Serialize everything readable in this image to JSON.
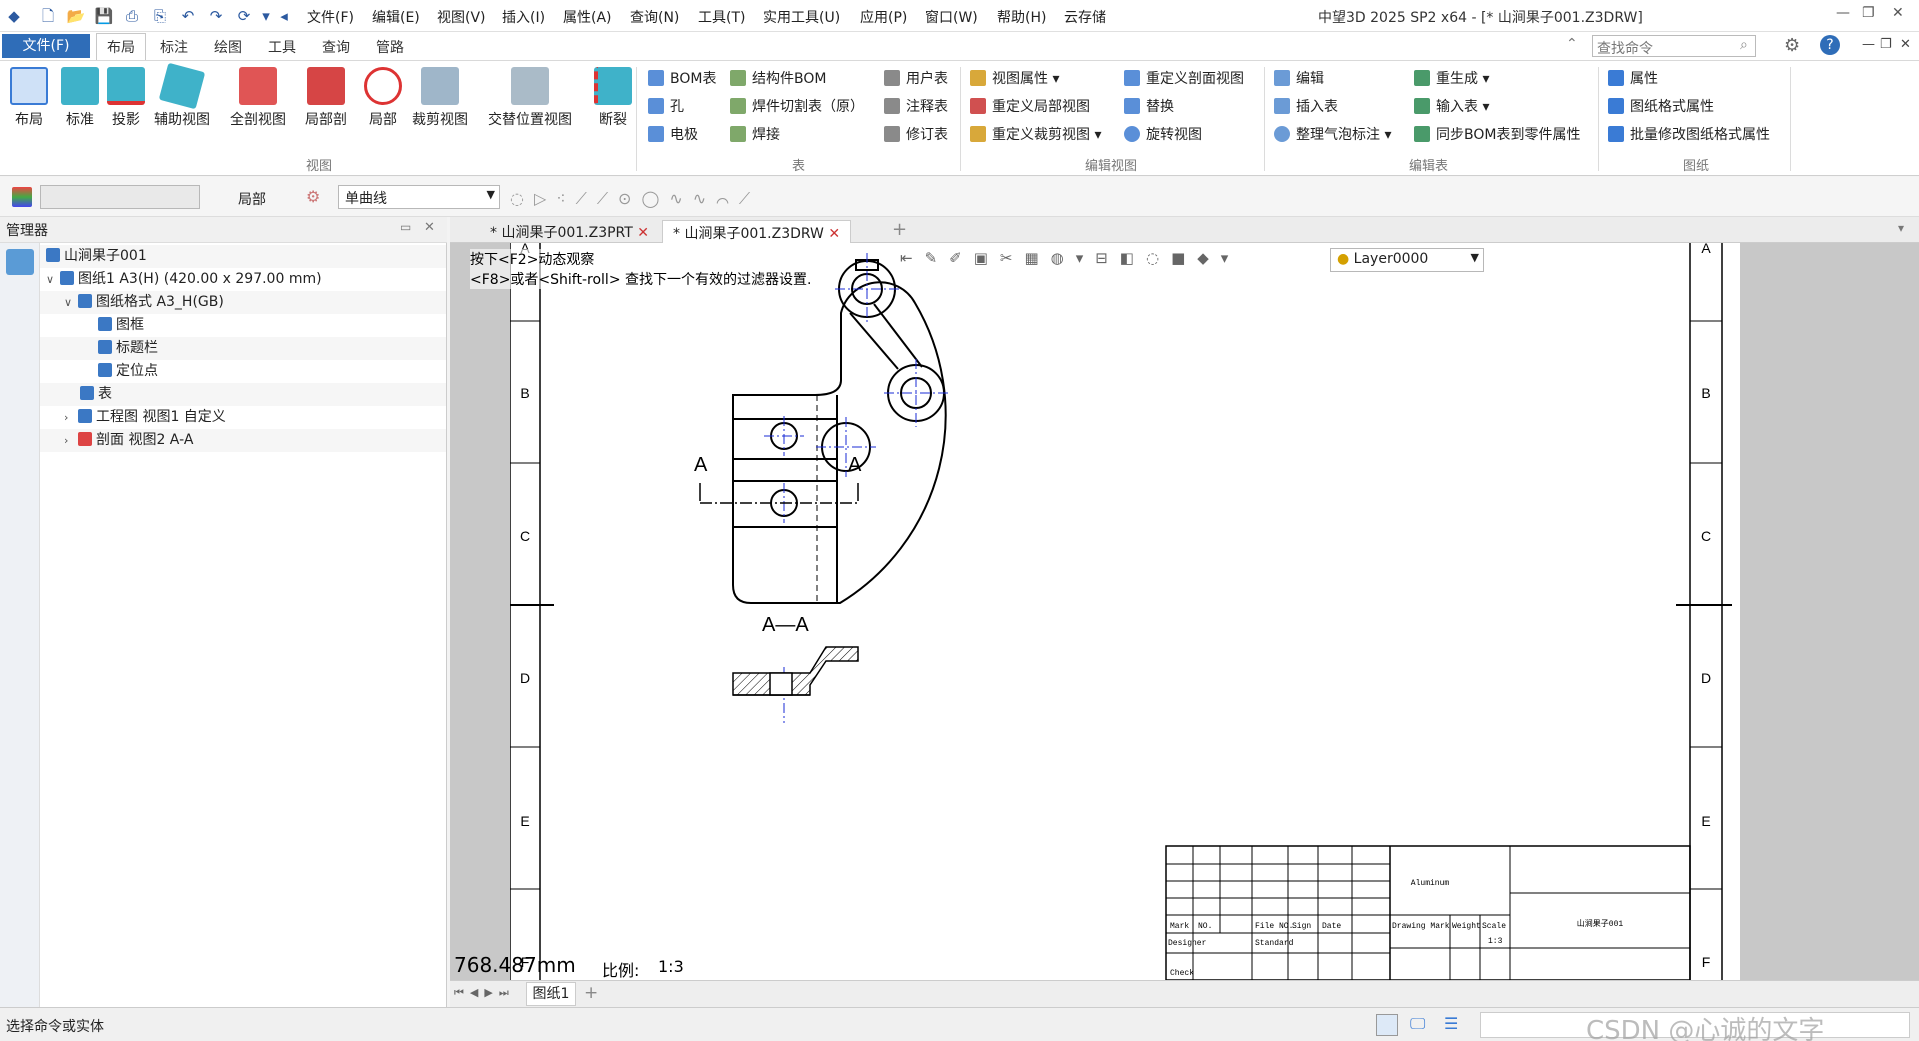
{
  "title_bar": {
    "menus": [
      "文件(F)",
      "编辑(E)",
      "视图(V)",
      "插入(I)",
      "属性(A)",
      "查询(N)",
      "工具(T)",
      "实用工具(U)",
      "应用(P)",
      "窗口(W)",
      "帮助(H)",
      "云存储"
    ],
    "window_title": "中望3D 2025 SP2 x64 - [* 山涧果子001.Z3DRW]"
  },
  "ribbon_tabs": {
    "file": "文件(F)",
    "tabs": [
      "布局",
      "标注",
      "绘图",
      "工具",
      "查询",
      "管路"
    ],
    "active": "布局",
    "search_placeholder": "查找命令"
  },
  "ribbon": {
    "view_buttons": [
      "布局",
      "标准",
      "投影",
      "辅助视图",
      "全剖视图",
      "局部剖",
      "局部",
      "裁剪视图",
      "交替位置视图",
      "断裂"
    ],
    "view_group": "视图",
    "table_buttons": [
      "BOM表",
      "孔",
      "电极",
      "结构件BOM",
      "焊件切割表（原）",
      "焊接",
      "用户表",
      "注释表",
      "修订表"
    ],
    "table_group": "表",
    "editview_buttons": [
      "视图属性",
      "重定义局部视图",
      "重定义裁剪视图",
      "重定义剖面视图",
      "替换",
      "旋转视图"
    ],
    "editview_group": "编辑视图",
    "edittable_buttons": [
      "编辑",
      "插入表",
      "整理气泡标注",
      "重生成",
      "输入表",
      "同步BOM表到零件属性"
    ],
    "edittable_group": "编辑表",
    "sheet_buttons": [
      "属性",
      "图纸格式属性",
      "批量修改图纸格式属性"
    ],
    "sheet_group": "图纸"
  },
  "filter_bar": {
    "scope_label": "局部",
    "curve_type": "单曲线"
  },
  "manager": {
    "title": "管理器",
    "tree": [
      "山涧果子001",
      "图纸1 A3(H) (420.00 x 297.00 mm)",
      "图纸格式 A3_H(GB)",
      "图框",
      "标题栏",
      "定位点",
      "表",
      "工程图 视图1 自定义",
      "剖面 视图2 A-A"
    ]
  },
  "doc_tabs": [
    "* 山涧果子001.Z3PRT",
    "* 山涧果子001.Z3DRW"
  ],
  "canvas": {
    "hint1": "按下<F2>动态观察",
    "hint2": "<F8>或者<Shift-roll> 查找下一个有效的过滤器设置.",
    "layer": "Layer0000",
    "zone_labels": [
      "A",
      "B",
      "C",
      "D",
      "E",
      "F"
    ],
    "section_label": "A—A",
    "section_arrow": "A",
    "measure": "768.487mm",
    "scale_label": "比例:",
    "scale_value": "1:3",
    "title_block": {
      "material": "Aluminum",
      "name": "山涧果子001",
      "headers": [
        "Mark",
        "NO.",
        "File NO.",
        "Sign",
        "Date"
      ],
      "designer": "Designer",
      "standard": "Standard",
      "check": "Check",
      "drawing_mark": "Drawing Mark",
      "weight": "Weight",
      "scale": "Scale",
      "scale_value": "1:3"
    }
  },
  "sheet_tab": "图纸1",
  "status": {
    "prompt": "选择命令或实体",
    "watermark": "CSDN @心诚的文字"
  }
}
